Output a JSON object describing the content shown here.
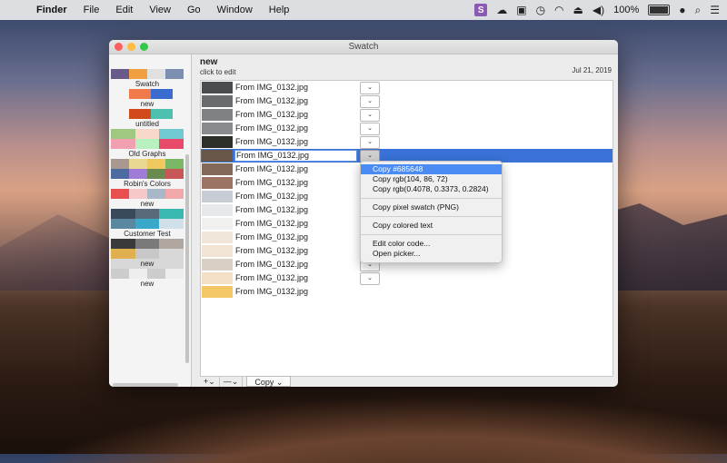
{
  "menubar": {
    "apple": "",
    "items": [
      "Finder",
      "File",
      "Edit",
      "View",
      "Go",
      "Window",
      "Help"
    ],
    "swatch_icon": "S",
    "battery_text": "100%"
  },
  "window": {
    "title": "Swatch"
  },
  "sidebar": {
    "palettes": [
      {
        "label": "Swatch",
        "colors": [
          "#6a5a8a",
          "#f0a040",
          "#e0e0e0",
          "#7c8fb0"
        ]
      },
      {
        "label": "new",
        "colors": [
          "#f07a4a",
          "#3a6cd0"
        ]
      },
      {
        "label": "untitled",
        "colors": [
          "#d04a1c",
          "#4ec0b0"
        ]
      },
      {
        "label": "Old Graphs",
        "colors": [
          "#a0c880",
          "#f8d8c8",
          "#70c8d0",
          "#f0a0b0",
          "#b8f0c0",
          "#e84a6a"
        ]
      },
      {
        "label": "Robin's Colors",
        "colors": [
          "#a89890",
          "#e8d890",
          "#f0c860",
          "#7ab868",
          "#4c6ca0",
          "#a07cd8",
          "#6a8a50",
          "#c85858"
        ]
      },
      {
        "label": "new",
        "colors": [
          "#e85050",
          "#f8c8c8",
          "#a8b8c8",
          "#f0a8a8"
        ]
      },
      {
        "label": "Customer Test",
        "colors": [
          "#3a4a5a",
          "#5a6a7a",
          "#38b8b0",
          "#5a88a0",
          "#3aa8c8",
          "#d0e0e8"
        ]
      },
      {
        "label": "new",
        "colors": [
          "#3a3a3a",
          "#7a7a7a",
          "#b0a8a0",
          "#e0b050",
          "#c8c8c8"
        ]
      },
      {
        "label": "new",
        "colors": [
          "#cccccc",
          "#eeeeee",
          "#cccccc",
          "#eeeeee"
        ]
      }
    ],
    "toolbar": {
      "add": "+",
      "remove": "—⌄",
      "gear": "✻⌄"
    }
  },
  "main": {
    "title": "new",
    "subtitle": "click to edit",
    "date": "Jul 21, 2019",
    "rows": [
      {
        "name": "From IMG_0132.jpg",
        "color": "#4b4c50",
        "popup": true
      },
      {
        "name": "From IMG_0132.jpg",
        "color": "#6a6b6e",
        "popup": true
      },
      {
        "name": "From IMG_0132.jpg",
        "color": "#808184",
        "popup": true
      },
      {
        "name": "From IMG_0132.jpg",
        "color": "#8a8b8d",
        "popup": true
      },
      {
        "name": "From IMG_0132.jpg",
        "color": "#2c2e28",
        "popup": true
      },
      {
        "name": "From IMG_0132.jpg",
        "color": "#685648",
        "popup": true,
        "selected": true
      },
      {
        "name": "From IMG_0132.jpg",
        "color": "#836a58",
        "popup": false
      },
      {
        "name": "From IMG_0132.jpg",
        "color": "#9c7464",
        "popup": false
      },
      {
        "name": "From IMG_0132.jpg",
        "color": "#c8ccd4",
        "popup": false
      },
      {
        "name": "From IMG_0132.jpg",
        "color": "#e6e8ea",
        "popup": false
      },
      {
        "name": "From IMG_0132.jpg",
        "color": "#f0f0ee",
        "popup": false
      },
      {
        "name": "From IMG_0132.jpg",
        "color": "#f0e6da",
        "popup": false
      },
      {
        "name": "From IMG_0132.jpg",
        "color": "#f2e4d4",
        "popup": false
      },
      {
        "name": "From IMG_0132.jpg",
        "color": "#d8d0c4",
        "popup": true
      },
      {
        "name": "From IMG_0132.jpg",
        "color": "#f4e0c4",
        "popup": true
      },
      {
        "name": "From IMG_0132.jpg",
        "color": "#f4c864",
        "popup": false
      }
    ],
    "toolbar": {
      "add": "+⌄",
      "remove": "—⌄",
      "copy": "Copy ⌄"
    }
  },
  "context_menu": {
    "groups": [
      [
        "Copy #685648",
        "Copy rgb(104, 86, 72)",
        "Copy rgb(0.4078, 0.3373, 0.2824)"
      ],
      [
        "Copy pixel swatch (PNG)"
      ],
      [
        "Copy colored text"
      ],
      [
        "Edit color code...",
        "Open picker..."
      ]
    ],
    "highlighted": "Copy #685648"
  }
}
